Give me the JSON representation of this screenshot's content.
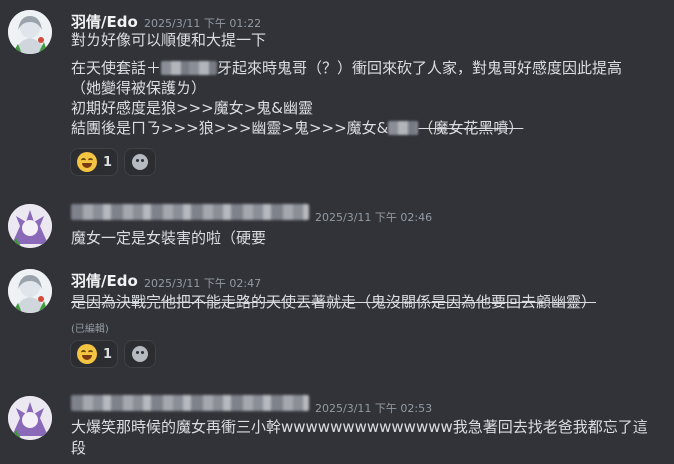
{
  "messages": [
    {
      "author": "羽倩/Edo",
      "timestamp": "2025/3/11 下午 01:22",
      "lines": {
        "l1": "對ㄌ好像可以順便和大提一下",
        "l2a": "在天使套話＋",
        "l2b": "牙起來時鬼哥（？）衝回來砍了人家，對鬼哥好感度因此提高",
        "l3": "（她變得被保護ㄌ）",
        "l4": "初期好感度是狼>>>魔女>鬼&幽靈",
        "l5a": "結團後是ㄇㄋ>>>狼>>>幽靈>鬼>>>魔女&",
        "l5b": "（魔女花黑噴）"
      },
      "reaction": {
        "emoji": "rolling-on-floor-laughing",
        "count": "1"
      }
    },
    {
      "author": "",
      "timestamp": "2025/3/11 下午 02:46",
      "lines": {
        "l1": "魔女一定是女裝害的啦（硬要"
      }
    },
    {
      "author": "羽倩/Edo",
      "timestamp": "2025/3/11 下午 02:47",
      "lines": {
        "l1": "是因為決戰完他把不能走路的天使丟著就走（鬼沒關係是因為他要回去顧幽靈）"
      },
      "edited": "(已編輯)",
      "reaction": {
        "emoji": "rolling-on-floor-laughing",
        "count": "1"
      }
    },
    {
      "author": "",
      "timestamp": "2025/3/11 下午 02:53",
      "lines": {
        "l1": "大爆笑那時候的魔女再衝三小幹wwwwwwwwwwwwww我急著回去找老爸我都忘了這",
        "l2": "段"
      }
    }
  ],
  "colors": {
    "background": "#313338",
    "text": "#dbdee1",
    "muted": "#949ba4",
    "reaction_bg": "#2b2d31"
  }
}
